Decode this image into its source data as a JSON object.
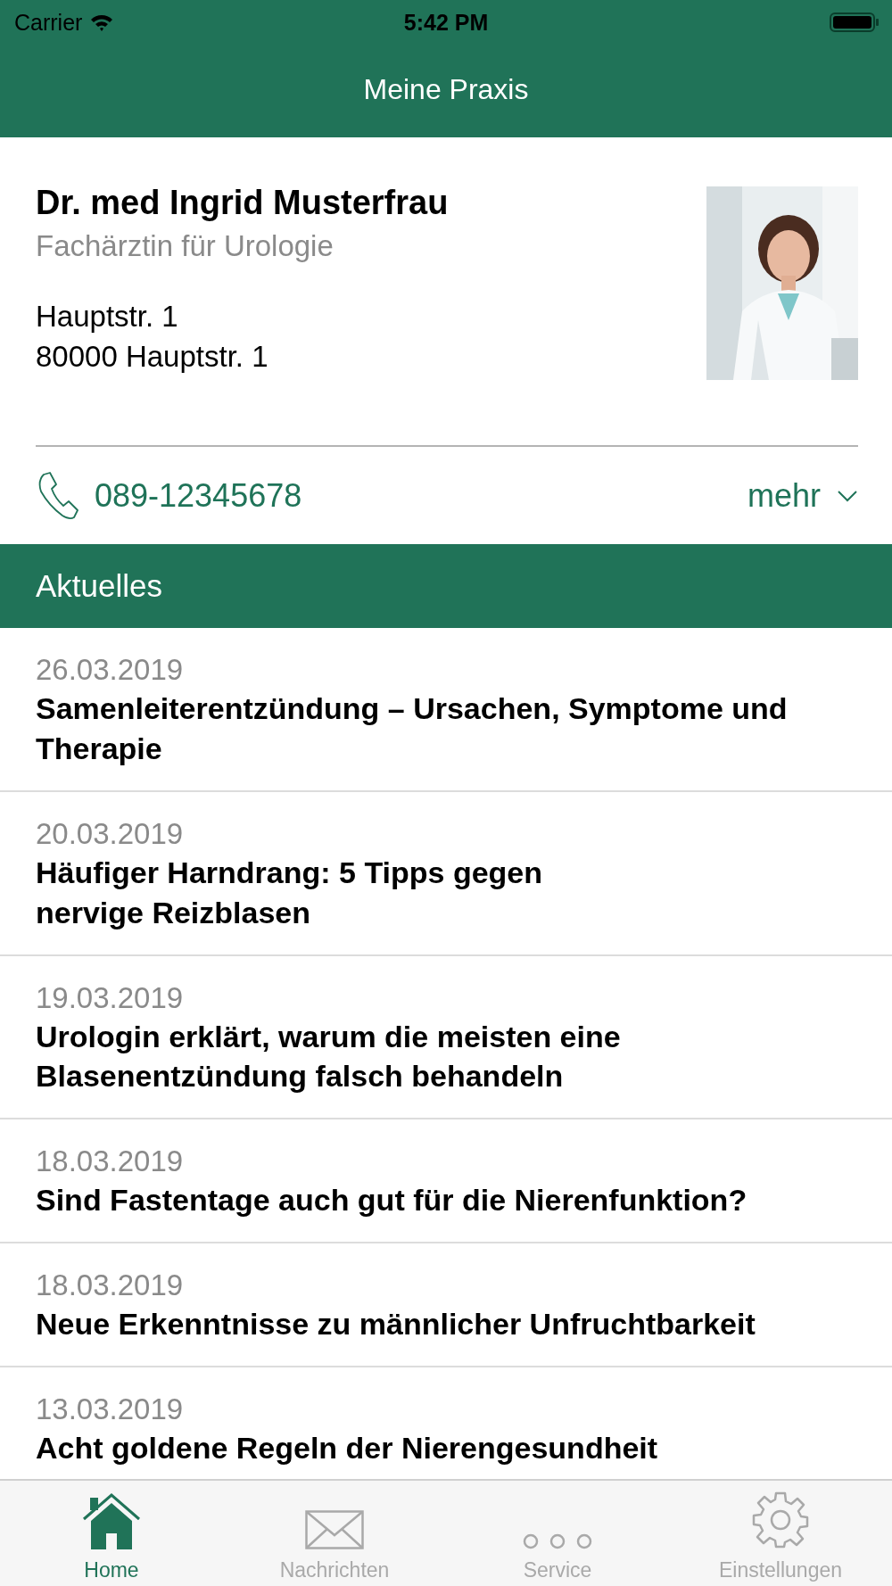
{
  "status_bar": {
    "carrier": "Carrier",
    "time": "5:42 PM"
  },
  "nav": {
    "title": "Meine Praxis"
  },
  "profile": {
    "name": "Dr. med Ingrid Musterfrau",
    "specialty": "Fachärztin für Urologie",
    "address": [
      "Hauptstr. 1",
      "80000 Hauptstr. 1"
    ]
  },
  "contact": {
    "phone": "089-12345678",
    "more": "mehr"
  },
  "section": {
    "title": "Aktuelles"
  },
  "news": [
    {
      "date": "26.03.2019",
      "title": "Samenleiterentzündung – Ursachen, Symptome und Therapie"
    },
    {
      "date": "20.03.2019",
      "title": "Häufiger Harndrang: 5 Tipps gegen nervige Reizblasen"
    },
    {
      "date": "19.03.2019",
      "title": "Urologin erklärt, warum die meisten eine Blasenentzündung falsch behandeln"
    },
    {
      "date": "18.03.2019",
      "title": "Sind Fastentage auch gut für die Nierenfunktion?"
    },
    {
      "date": "18.03.2019",
      "title": "Neue Erkenntnisse zu männlicher Unfruchtbarkeit"
    },
    {
      "date": "13.03.2019",
      "title": "Acht goldene Regeln der Nierengesundheit"
    }
  ],
  "tab_bar": [
    {
      "kind": "home",
      "label": "Home",
      "selected": true
    },
    {
      "kind": "mail",
      "label": "Nachrichten",
      "selected": false
    },
    {
      "kind": "more",
      "label": "Service",
      "selected": false
    },
    {
      "kind": "settings",
      "label": "Einstellungen",
      "selected": false
    }
  ]
}
